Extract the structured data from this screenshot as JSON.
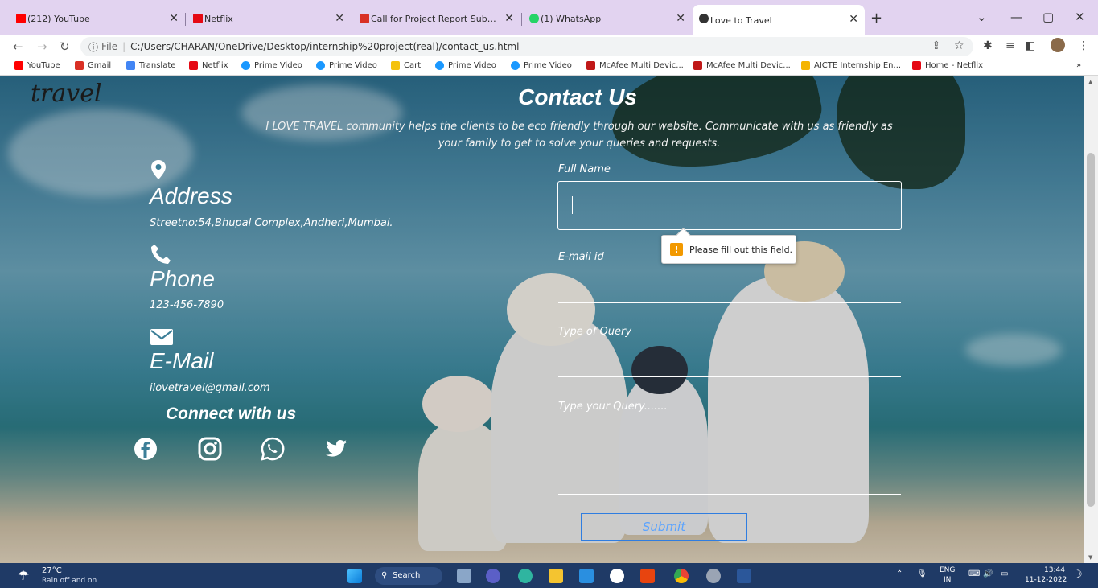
{
  "browser": {
    "tabs": [
      {
        "label": "(212) YouTube",
        "color": "#ff0000"
      },
      {
        "label": "Netflix",
        "color": "#e50914"
      },
      {
        "label": "Call for Project Report Submissior",
        "color": "#d93025"
      },
      {
        "label": "(1) WhatsApp",
        "color": "#25d366"
      },
      {
        "label": "Love to Travel",
        "color": "#333333"
      }
    ],
    "address": {
      "scheme": "File",
      "url": "C:/Users/CHARAN/OneDrive/Desktop/internship%20project(real)/contact_us.html"
    },
    "bookmarks": [
      {
        "label": "YouTube",
        "color": "#ff0000"
      },
      {
        "label": "Gmail",
        "color": "#d93025"
      },
      {
        "label": "Translate",
        "color": "#4285f4"
      },
      {
        "label": "Netflix",
        "color": "#e50914"
      },
      {
        "label": "Prime Video",
        "color": "#1a98ff"
      },
      {
        "label": "Prime Video",
        "color": "#1a98ff"
      },
      {
        "label": "Cart",
        "color": "#f4c20d"
      },
      {
        "label": "Prime Video",
        "color": "#1a98ff"
      },
      {
        "label": "Prime Video",
        "color": "#1a98ff"
      },
      {
        "label": "McAfee Multi Devic...",
        "color": "#c01818"
      },
      {
        "label": "McAfee Multi Devic...",
        "color": "#c01818"
      },
      {
        "label": "AICTE Internship En...",
        "color": "#f4b400"
      },
      {
        "label": "Home - Netflix",
        "color": "#e50914"
      }
    ],
    "more_bookmarks": "»"
  },
  "page": {
    "logo": "travel",
    "heading": "Contact Us",
    "intro": "I LOVE TRAVEL community helps the clients to be eco friendly through our website. Communicate with us as friendly as your family to get to solve your queries and requests.",
    "info": {
      "address": {
        "title": "Address",
        "text": "Streetno:54,Bhupal Complex,Andheri,Mumbai."
      },
      "phone": {
        "title": "Phone",
        "text": "123-456-7890"
      },
      "email": {
        "title": "E-Mail",
        "text": "ilovetravel@gmail.com"
      }
    },
    "connect_title": "Connect with us",
    "social": [
      "facebook-icon",
      "instagram-icon",
      "whatsapp-icon",
      "twitter-icon"
    ],
    "form": {
      "full_name_label": "Full Name",
      "email_label": "E-mail id",
      "query_type_label": "Type of Query",
      "query_label": "Type your Query.......",
      "submit_label": "Submit",
      "validation_message": "Please fill out this field."
    }
  },
  "taskbar": {
    "weather_temp": "27°C",
    "weather_text": "Rain off and on",
    "search_label": "Search",
    "lang": "ENG",
    "region": "IN",
    "time": "13:44",
    "date": "11-12-2022"
  },
  "colors": {
    "accent_button": "#2f7de0",
    "warning": "#f29900",
    "taskbar": "#1f3a66"
  }
}
